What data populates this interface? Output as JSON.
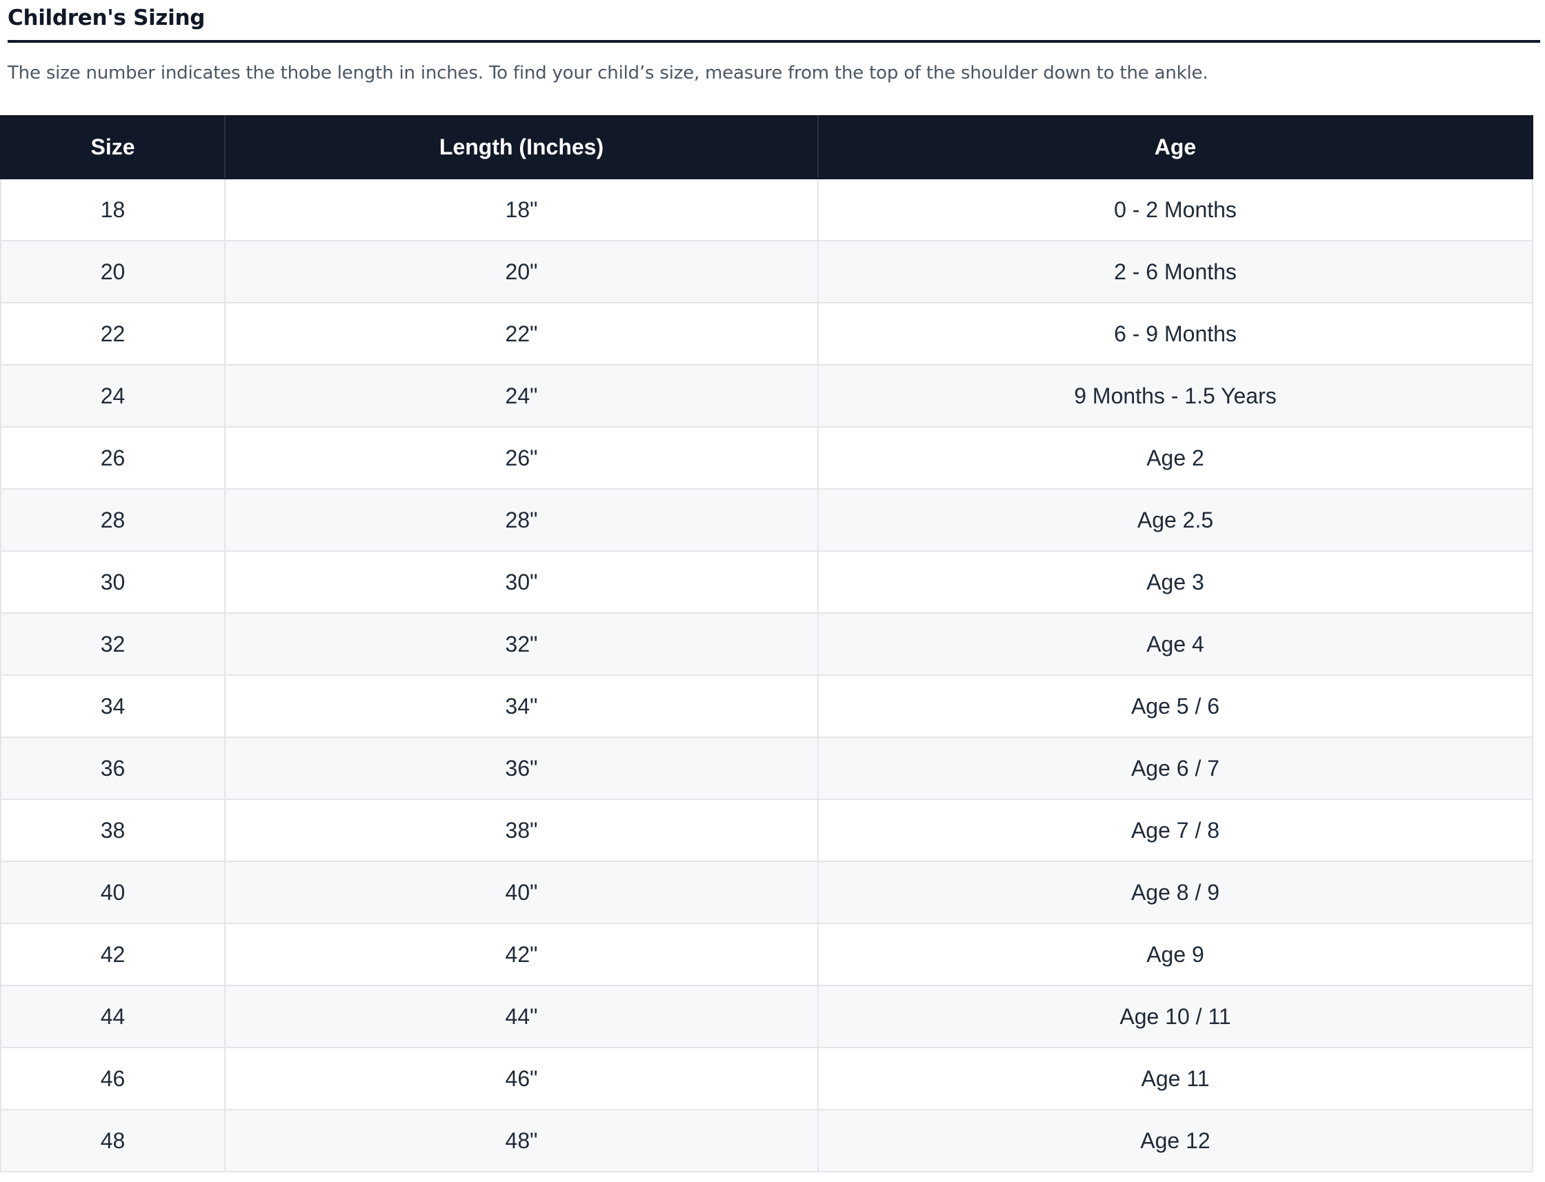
{
  "section": {
    "title": "Children's Sizing",
    "description": "The size number indicates the thobe length in inches. To find your child’s size, measure from the top of the shoulder down to the ankle."
  },
  "table": {
    "headers": [
      "Size",
      "Length (Inches)",
      "Age"
    ],
    "rows": [
      [
        "18",
        "18\"",
        "0 - 2 Months"
      ],
      [
        "20",
        "20\"",
        "2 - 6 Months"
      ],
      [
        "22",
        "22\"",
        "6 - 9 Months"
      ],
      [
        "24",
        "24\"",
        "9 Months - 1.5 Years"
      ],
      [
        "26",
        "26\"",
        "Age 2"
      ],
      [
        "28",
        "28\"",
        "Age 2.5"
      ],
      [
        "30",
        "30\"",
        "Age 3"
      ],
      [
        "32",
        "32\"",
        "Age 4"
      ],
      [
        "34",
        "34\"",
        "Age 5 / 6"
      ],
      [
        "36",
        "36\"",
        "Age 6 / 7"
      ],
      [
        "38",
        "38\"",
        "Age 7 / 8"
      ],
      [
        "40",
        "40\"",
        "Age 8 / 9"
      ],
      [
        "42",
        "42\"",
        "Age 9"
      ],
      [
        "44",
        "44\"",
        "Age 10 / 11"
      ],
      [
        "46",
        "46\"",
        "Age 11"
      ],
      [
        "48",
        "48\"",
        "Age 12"
      ]
    ]
  },
  "colors": {
    "header_bg": "#111827",
    "header_text": "#ffffff",
    "stripe": "#f7f8fa",
    "border": "#e2e5ea"
  }
}
